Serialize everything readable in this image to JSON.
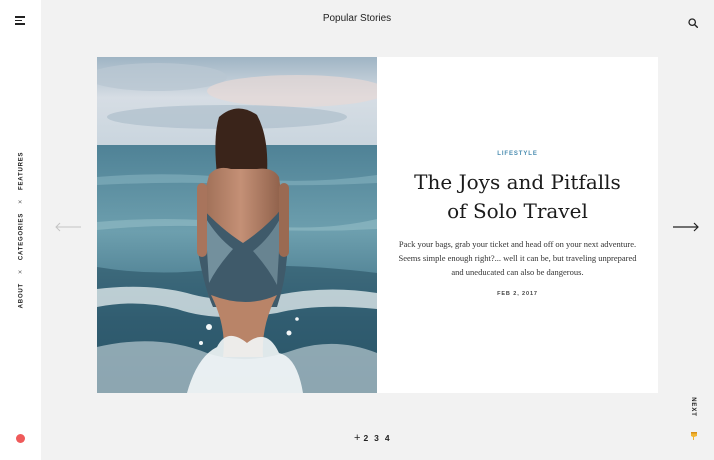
{
  "header": {
    "title": "Popular Stories"
  },
  "sidebar": {
    "nav_items": [
      "ABOUT",
      "CATEGORIES",
      "FEATURES"
    ],
    "separator": "×"
  },
  "icons": {
    "menu": "menu-icon",
    "search": "search-icon",
    "prev": "arrow-left-icon",
    "next": "arrow-right-icon",
    "status_dot": "record-dot-icon",
    "pin": "pin-icon"
  },
  "story": {
    "category": "LIFESTYLE",
    "title_line1": "The Joys and Pitfalls",
    "title_line2": "of Solo Travel",
    "excerpt": "Pack your bags, grab your ticket and head off on your next adventure. Seems simple enough right?... well it can be, but traveling unprepared and uneducated can also be dangerous.",
    "date": "FEB 2, 2017",
    "image_alt": "Woman in swimsuit wading into ocean waves"
  },
  "navigation": {
    "next_label": "NEXT"
  },
  "pagination": {
    "marker": "+",
    "pages": [
      "2",
      "3",
      "4"
    ]
  },
  "colors": {
    "accent": "#4a8cb0",
    "dot": "#ef5a5a",
    "background": "#f2f2f2"
  }
}
